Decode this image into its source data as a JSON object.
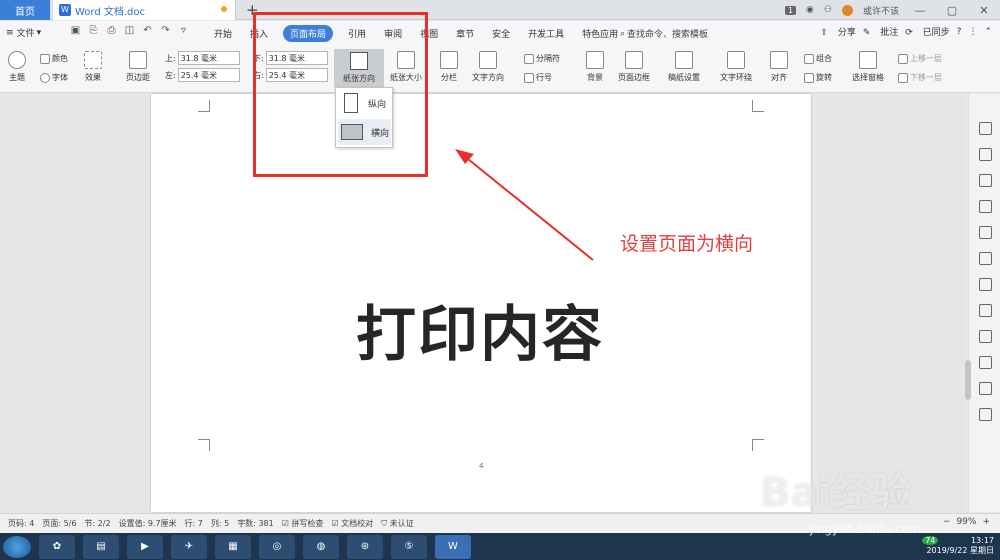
{
  "tabbar": {
    "home_label": "首页",
    "doc_label": "Word 文档.doc",
    "plus": "+",
    "badge": "1",
    "user_label": "或许不该",
    "minimize": "—",
    "restore": "▢",
    "close": "✕"
  },
  "menubar": {
    "file_label": "文件",
    "tabs": [
      {
        "label": "开始"
      },
      {
        "label": "插入"
      },
      {
        "label": "页面布局"
      },
      {
        "label": "引用"
      },
      {
        "label": "审阅"
      },
      {
        "label": "视图"
      },
      {
        "label": "章节"
      },
      {
        "label": "安全"
      },
      {
        "label": "开发工具"
      },
      {
        "label": "特色应用"
      }
    ],
    "search_label": "查找命令、搜索模板",
    "share": "分享",
    "comment": "批注",
    "sync": "已同步",
    "help": "?"
  },
  "ribbon": {
    "theme": "主题",
    "color": "颜色",
    "font": "字体",
    "effect": "效果",
    "margins": "页边距",
    "top_label": "上:",
    "top_value": "31.8 毫米",
    "bottom_label": "下:",
    "bottom_value": "31.8 毫米",
    "left_label": "左:",
    "left_value": "25.4 毫米",
    "right_label": "右:",
    "right_value": "25.4 毫米",
    "orientation": "纸张方向",
    "paper_size": "纸张大小",
    "columns": "分栏",
    "text_direction": "文字方向",
    "breaks": "分隔符",
    "line_numbers": "行号",
    "background": "背景",
    "page_border": "页面边框",
    "manuscript": "稿纸设置",
    "wrap_text": "文字环绕",
    "align": "对齐",
    "group": "组合",
    "rotate": "旋转",
    "selection_pane": "选择窗格",
    "bring_forward": "上移一层",
    "send_backward": "下移一层"
  },
  "dropdown": {
    "portrait": "纵向",
    "landscape": "横向"
  },
  "document": {
    "main_text": "打印内容",
    "page_number": "4"
  },
  "annotation": {
    "text": "设置页面为横向",
    "color": "#e8302a"
  },
  "statusbar": {
    "page_code": "页码: 4",
    "page": "页面: 5/6",
    "section": "节: 2/2",
    "position": "设置值: 9.7厘米",
    "row": "行: 7",
    "column": "列: 5",
    "word_count": "字数: 381",
    "spell_check": "拼写检查",
    "doc_proof": "文档校对",
    "certification": "未认证",
    "zoom": "99%"
  },
  "taskbar": {
    "time": "13:17",
    "date": "2019/9/22 星期日",
    "tray_badge": "74"
  },
  "watermark": {
    "main": "Bai经验",
    "sub": "jingyan.baidu.com"
  }
}
